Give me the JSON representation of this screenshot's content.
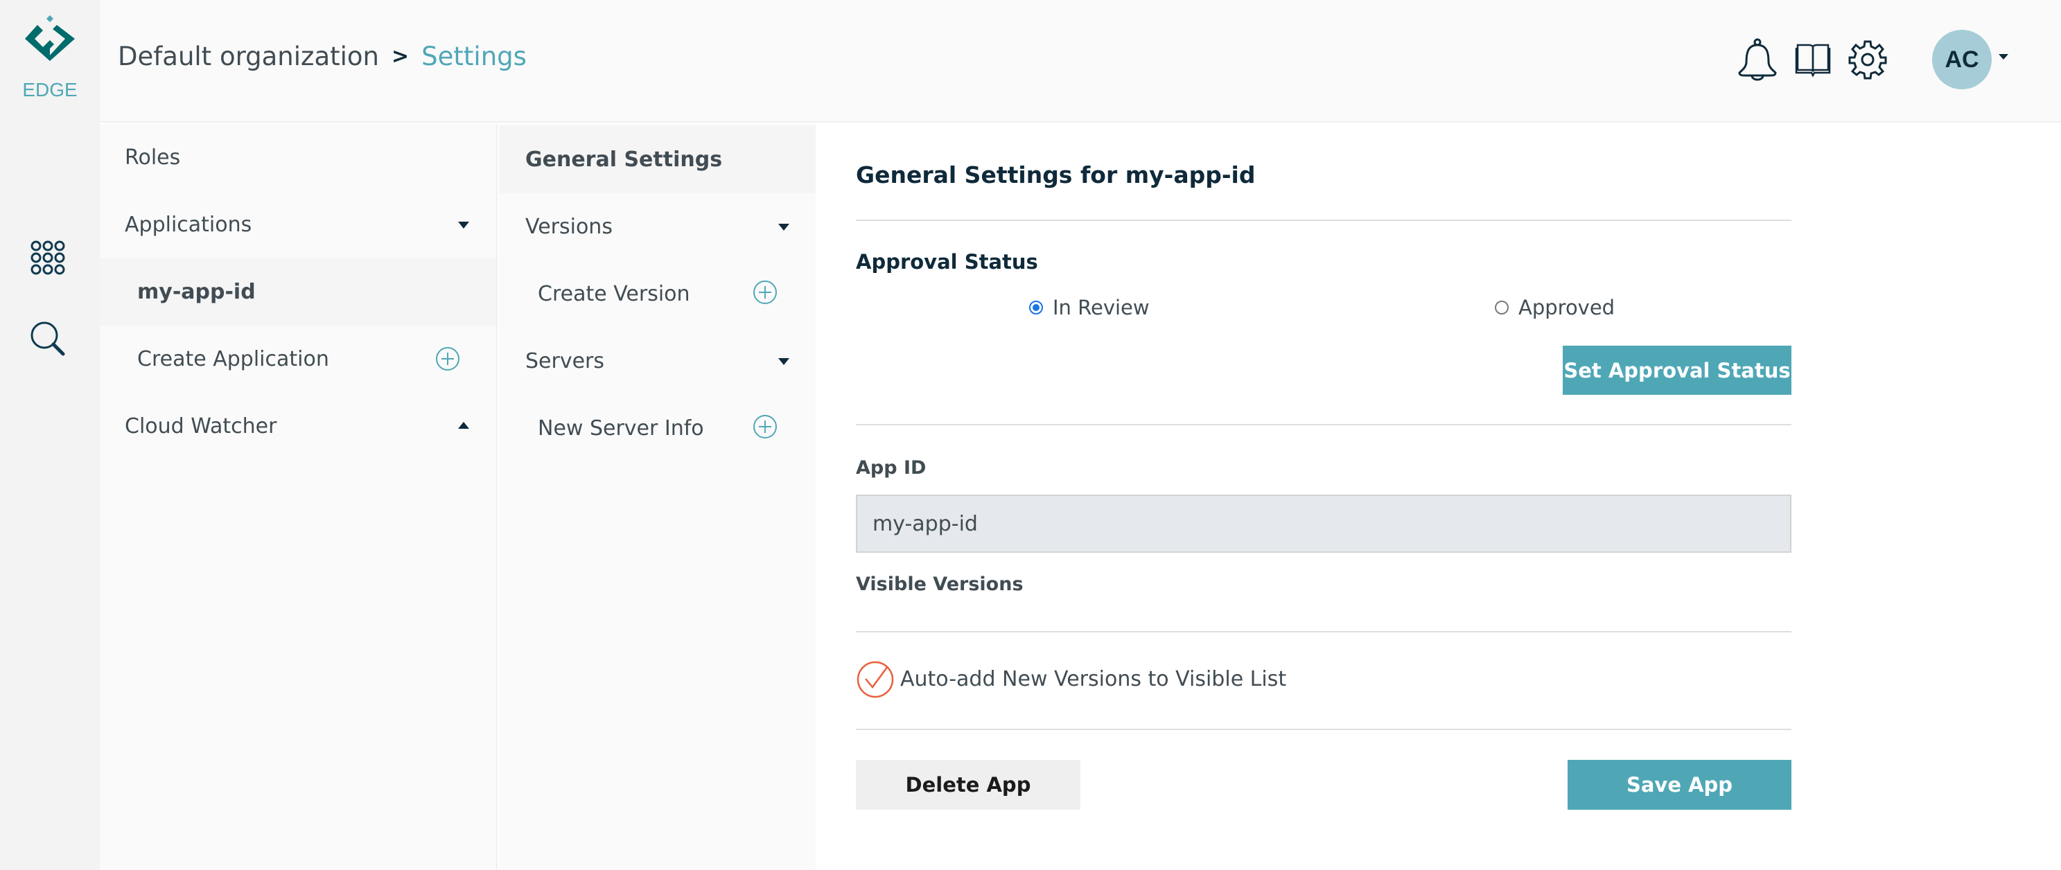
{
  "brand": {
    "name": "EDGE",
    "primary_color": "#4fa7b6",
    "dark_color": "#006b6b"
  },
  "rail": {
    "items": [
      {
        "icon": "apps-grid-icon",
        "label": "Apps"
      },
      {
        "icon": "search-icon",
        "label": "Search"
      }
    ]
  },
  "header": {
    "breadcrumb": {
      "root": "Default organization",
      "separator": ">",
      "current": "Settings"
    },
    "icons": [
      "bell-icon",
      "book-icon",
      "gear-icon"
    ],
    "user": {
      "initials": "AC"
    }
  },
  "panel1": {
    "items": [
      {
        "label": "Roles",
        "type": "link"
      },
      {
        "label": "Applications",
        "type": "group",
        "caret": "down"
      },
      {
        "label": "my-app-id",
        "type": "child",
        "active": true
      },
      {
        "label": "Create Application",
        "type": "add"
      },
      {
        "label": "Cloud Watcher",
        "type": "group",
        "caret": "up"
      }
    ]
  },
  "panel2": {
    "items": [
      {
        "label": "General Settings",
        "type": "link",
        "active": true
      },
      {
        "label": "Versions",
        "type": "group",
        "caret": "down"
      },
      {
        "label": "Create Version",
        "type": "add"
      },
      {
        "label": "Servers",
        "type": "group",
        "caret": "down"
      },
      {
        "label": "New Server Info",
        "type": "add"
      }
    ]
  },
  "main": {
    "title": "General Settings for my-app-id",
    "approval": {
      "label": "Approval Status",
      "options": [
        {
          "label": "In Review",
          "checked": true
        },
        {
          "label": "Approved",
          "checked": false
        }
      ],
      "button": "Set Approval Status"
    },
    "app_id": {
      "label": "App ID",
      "value": "my-app-id"
    },
    "visible_versions": {
      "label": "Visible Versions"
    },
    "auto_add": {
      "label": "Auto-add New Versions to Visible List",
      "checked": true,
      "color": "#e8603c"
    },
    "actions": {
      "delete": "Delete App",
      "save": "Save App"
    }
  }
}
